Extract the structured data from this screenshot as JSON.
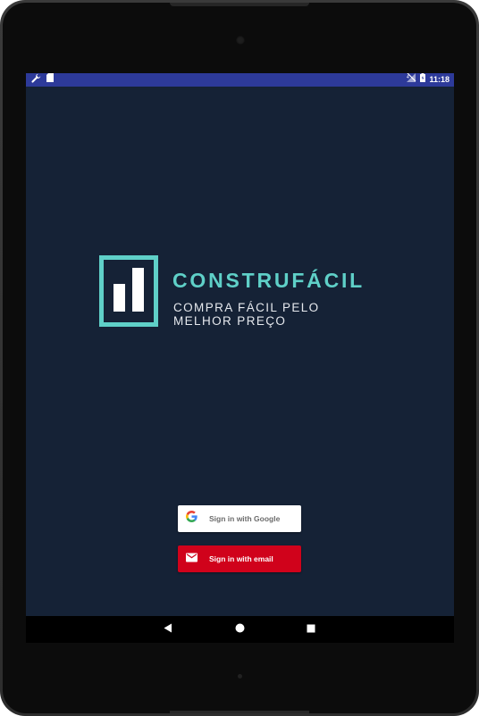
{
  "status_bar": {
    "time": "11:18",
    "left_icons": [
      "wrench-icon",
      "sd-card-icon"
    ],
    "right_icons": [
      "signal-off-icon",
      "battery-icon"
    ]
  },
  "brand": {
    "name": "CONSTRUFÁCIL",
    "tagline": "COMPRA FÁCIL PELO MELHOR PREÇO",
    "logo_color": "#5fd0c8"
  },
  "auth": {
    "google_label": "Sign in with Google",
    "email_label": "Sign in with email"
  },
  "nav": {
    "buttons": [
      "back-icon",
      "home-icon",
      "recents-icon"
    ]
  },
  "colors": {
    "status_bar": "#2d3a9a",
    "background": "#152236",
    "accent": "#5fd0c8",
    "email_button": "#d0021b",
    "google_button": "#ffffff"
  }
}
